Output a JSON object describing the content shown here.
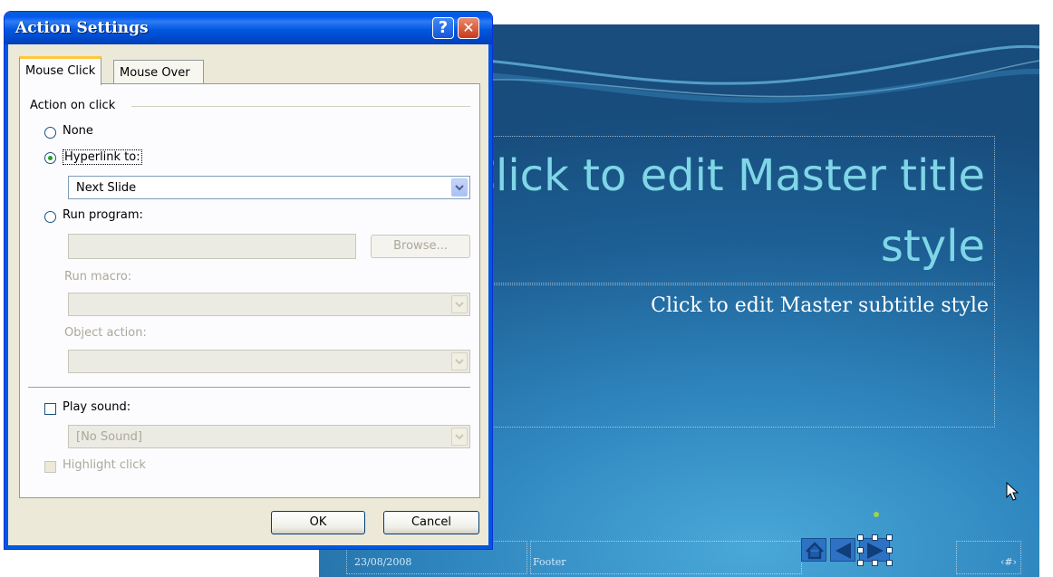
{
  "dialog": {
    "title": "Action Settings",
    "help_glyph": "?",
    "close_glyph": "✕",
    "tabs": [
      {
        "label": "Mouse Click",
        "active": true
      },
      {
        "label": "Mouse Over",
        "active": false
      }
    ],
    "group_label": "Action on click",
    "options": {
      "none": {
        "label": "None",
        "selected": false
      },
      "hyperlink": {
        "label": "Hyperlink to:",
        "selected": true
      },
      "run_program": {
        "label": "Run program:",
        "selected": false
      }
    },
    "hyperlink_value": "Next Slide",
    "run_program_value": "",
    "browse_label": "Browse...",
    "run_macro_label": "Run macro:",
    "run_macro_value": "",
    "object_action_label": "Object action:",
    "object_action_value": "",
    "play_sound": {
      "label": "Play sound:",
      "checked": false
    },
    "sound_value": "[No Sound]",
    "highlight_label": "Highlight click",
    "ok_label": "OK",
    "cancel_label": "Cancel"
  },
  "slide": {
    "title_line1": "Click to edit Master title",
    "title_line2": "style",
    "subtitle": "Click to edit Master subtitle style",
    "date": "23/08/2008",
    "footer": "Footer",
    "slide_number": "‹#›",
    "nav_buttons": [
      "home-icon",
      "back-icon",
      "forward-icon"
    ],
    "colors": {
      "title": "#7fd6e6",
      "background": "#1d5f94",
      "button": "#2e72c4"
    }
  },
  "colors": {
    "titlebar": "#0058e0",
    "dialog_bg": "#ece9d8",
    "tab_highlight": "#ffc83c"
  }
}
